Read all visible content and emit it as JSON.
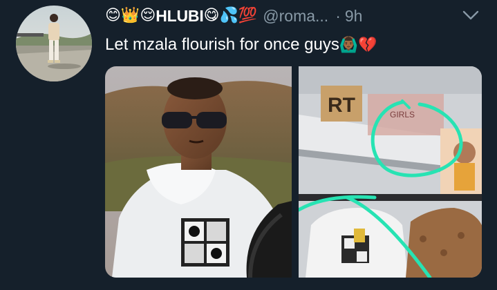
{
  "tweet": {
    "author": {
      "display_name": "HLUBI",
      "name_emojis_before": "😊👑😌",
      "name_emojis_after": "😋💦💯",
      "handle": "@roma...",
      "avatar_icon": "profile-photo"
    },
    "separator": "·",
    "timestamp": "9h",
    "text": "Let mzala flourish for once guys",
    "text_emojis": "🙆🏾‍♂️💔",
    "media": {
      "left_image": "photo-man-sunglasses-white-hoodie",
      "right_image": "photo-store-shelf-hoodies-circled",
      "shelf_sign": "RT",
      "shelf_label": "GIRLS"
    },
    "colors": {
      "background": "#15202b",
      "secondary_text": "#8899a6",
      "highlight_circle": "#27e3b3"
    }
  }
}
